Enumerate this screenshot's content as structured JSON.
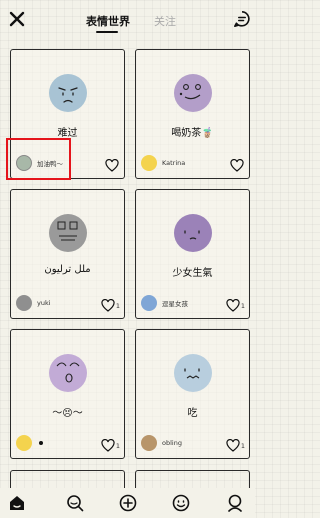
{
  "header": {
    "tab_active": "表情世界",
    "tab_inactive": "关注"
  },
  "cards": [
    {
      "title": "难过",
      "author": "加油鸭～",
      "likes": ""
    },
    {
      "title": "喝奶茶🧋",
      "author": "Katrina",
      "likes": ""
    },
    {
      "title": "ملل ترليون",
      "author": "yuki",
      "likes": "1"
    },
    {
      "title": "少女生氣",
      "author": "逗星女孩",
      "likes": "1"
    },
    {
      "title": "～😣～",
      "author": "",
      "likes": "1"
    },
    {
      "title": "吃",
      "author": "obling",
      "likes": "1"
    }
  ],
  "nav": [
    "home-icon",
    "search-icon",
    "add-icon",
    "smile-icon",
    "profile-icon"
  ],
  "colors": {
    "highlight": "#e5141b",
    "background": "#f3f2e9"
  }
}
